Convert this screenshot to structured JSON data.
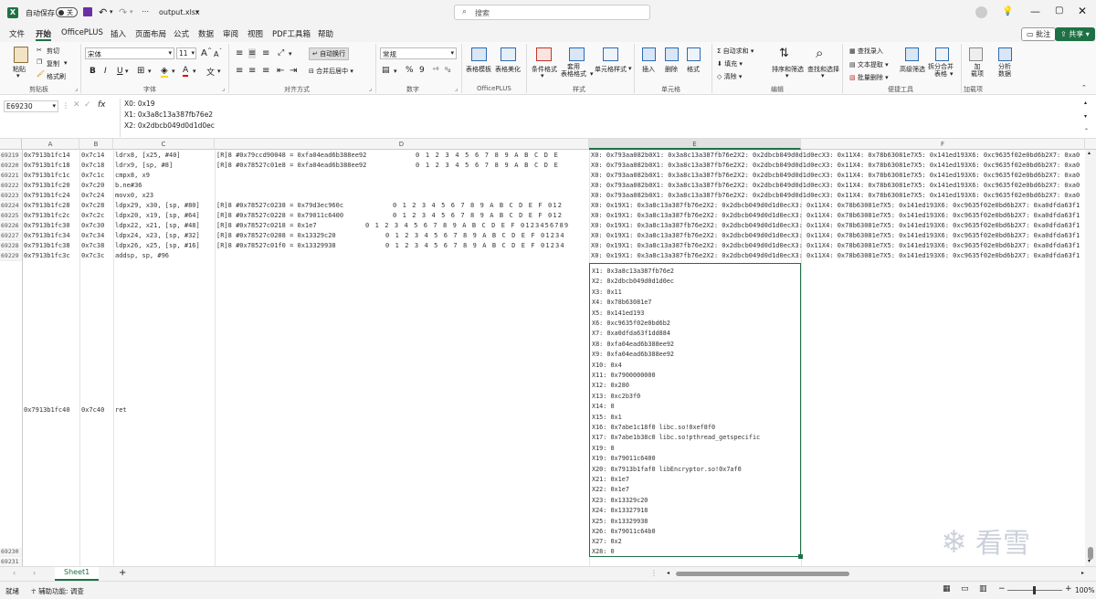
{
  "title_bar": {
    "autosave_label": "自动保存",
    "autosave_state": "关",
    "filename": "output.xlsx",
    "search_placeholder": "搜索"
  },
  "menu": [
    "文件",
    "开始",
    "OfficePLUS",
    "插入",
    "页面布局",
    "公式",
    "数据",
    "审阅",
    "视图",
    "PDF工具箱",
    "帮助"
  ],
  "menu_active": "开始",
  "menu_right": {
    "comment": "批注",
    "share": "共享"
  },
  "ribbon": {
    "clipboard": {
      "paste": "粘贴",
      "cut": "剪切",
      "copy": "复制",
      "format_painter": "格式刷",
      "group": "剪贴板"
    },
    "font": {
      "name": "宋体",
      "size": "11",
      "bold": "B",
      "italic": "I",
      "underline": "U",
      "grow": "A",
      "shrink": "A",
      "color": "A",
      "group": "字体"
    },
    "alignment": {
      "wrap": "自动换行",
      "merge": "合并后居中",
      "group": "对齐方式"
    },
    "number": {
      "format": "常规",
      "percent": "%",
      "comma": "9",
      "group": "数字"
    },
    "officeplus": {
      "table_template": "表格模板",
      "table_beautify": "表格美化",
      "group": "OfficePLUS"
    },
    "styles": {
      "conditional": "条件格式",
      "table_format": "套用\n表格格式",
      "cell_style": "单元格样式",
      "group": "样式"
    },
    "cells": {
      "insert": "插入",
      "delete": "删除",
      "format": "格式",
      "group": "单元格"
    },
    "editing": {
      "autosum": "自动求和",
      "fill": "填充",
      "clear": "清除",
      "sort": "排序和筛选",
      "find": "查找和选择",
      "group": "编辑"
    },
    "tools": {
      "find_insert": "查找录入",
      "text_extract": "文本提取",
      "batch_delete": "批量删除",
      "advanced_filter": "高级筛选",
      "split_merge": "拆分合并\n表格",
      "group": "便捷工具"
    },
    "addins": {
      "addin": "加\n载项",
      "analyze": "分析\n数据",
      "group": "加载项"
    }
  },
  "formula_bar": {
    "name_box": "E69230",
    "fx": "fx",
    "lines": [
      "X0: 0x19",
      "X1: 0x3a8c13a387fb76e2",
      "X2: 0x2dbcb049d0d1d0ec"
    ]
  },
  "columns": [
    "A",
    "B",
    "C",
    "D",
    "E",
    "F"
  ],
  "rows": [
    {
      "n": "69219",
      "a": "0x7913b1fc14",
      "b": "0x7c14",
      "c": "ldrx8, [x25, #40]",
      "d": "[R]8 #0x79ccd90048 = 0xfa04ead6b388ee92",
      "d2": "0 1 2 3 4 5 6 7 8 9 A B C D E",
      "e": "X0: 0x793aa082b0X1: 0x3a8c13a387fb76e2X2: 0x2dbcb049d0d1d0ecX3: 0x11X4: 0x78b63081e7X5: 0x141ed193X6: 0xc9635f02e0bd6b2X7: 0xa0"
    },
    {
      "n": "69220",
      "a": "0x7913b1fc18",
      "b": "0x7c18",
      "c": "ldrx9, [sp, #8]",
      "d": "[R]8 #0x78527c01e8 = 0xfa04ead6b388ee92",
      "d2": "0 1 2 3 4 5 6 7 8 9 A B C D E",
      "e": "X0: 0x793aa082b0X1: 0x3a8c13a387fb76e2X2: 0x2dbcb049d0d1d0ecX3: 0x11X4: 0x78b63081e7X5: 0x141ed193X6: 0xc9635f02e0bd6b2X7: 0xa0"
    },
    {
      "n": "69221",
      "a": "0x7913b1fc1c",
      "b": "0x7c1c",
      "c": "cmpx8, x9",
      "d": "",
      "d2": "",
      "e": "X0: 0x793aa082b0X1: 0x3a8c13a387fb76e2X2: 0x2dbcb049d0d1d0ecX3: 0x11X4: 0x78b63081e7X5: 0x141ed193X6: 0xc9635f02e0bd6b2X7: 0xa0"
    },
    {
      "n": "69222",
      "a": "0x7913b1fc20",
      "b": "0x7c20",
      "c": "b.ne#36",
      "d": "",
      "d2": "",
      "e": "X0: 0x793aa082b0X1: 0x3a8c13a387fb76e2X2: 0x2dbcb049d0d1d0ecX3: 0x11X4: 0x78b63081e7X5: 0x141ed193X6: 0xc9635f02e0bd6b2X7: 0xa0"
    },
    {
      "n": "69223",
      "a": "0x7913b1fc24",
      "b": "0x7c24",
      "c": "movx0, x23",
      "d": "",
      "d2": "",
      "e": "X0: 0x793aa082b0X1: 0x3a8c13a387fb76e2X2: 0x2dbcb049d0d1d0ecX3: 0x11X4: 0x78b63081e7X5: 0x141ed193X6: 0xc9635f02e0bd6b2X7: 0xa0"
    },
    {
      "n": "69224",
      "a": "0x7913b1fc28",
      "b": "0x7c28",
      "c": "ldpx29, x30, [sp, #80]",
      "d": "[R]8 #0x78527c0238 = 0x79d3ec960c",
      "d2": "0 1 2 3 4 5 6 7 8 9 A B C D E F 012",
      "e": "X0: 0x19X1: 0x3a8c13a387fb76e2X2: 0x2dbcb049d0d1d0ecX3: 0x11X4: 0x78b63081e7X5: 0x141ed193X6: 0xc9635f02e0bd6b2X7: 0xa0dfda63f1"
    },
    {
      "n": "69225",
      "a": "0x7913b1fc2c",
      "b": "0x7c2c",
      "c": "ldpx20, x19, [sp, #64]",
      "d": "[R]8 #0x78527c0228 = 0x79011c6400",
      "d2": "0 1 2 3 4 5 6 7 8 9 A B C D E F 012",
      "e": "X0: 0x19X1: 0x3a8c13a387fb76e2X2: 0x2dbcb049d0d1d0ecX3: 0x11X4: 0x78b63081e7X5: 0x141ed193X6: 0xc9635f02e0bd6b2X7: 0xa0dfda63f1"
    },
    {
      "n": "69226",
      "a": "0x7913b1fc30",
      "b": "0x7c30",
      "c": "ldpx22, x21, [sp, #48]",
      "d": "[R]8 #0x78527c0218 = 0x1e7",
      "d2": "0 1 2 3 4 5 6 7 8 9 A B C D E F 0123456789",
      "e": "X0: 0x19X1: 0x3a8c13a387fb76e2X2: 0x2dbcb049d0d1d0ecX3: 0x11X4: 0x78b63081e7X5: 0x141ed193X6: 0xc9635f02e0bd6b2X7: 0xa0dfda63f1"
    },
    {
      "n": "69227",
      "a": "0x7913b1fc34",
      "b": "0x7c34",
      "c": "ldpx24, x23, [sp, #32]",
      "d": "[R]8 #0x78527c0208 = 0x13329c20",
      "d2": "0 1 2 3 4 5 6 7 8 9 A B C D E F 01234",
      "e": "X0: 0x19X1: 0x3a8c13a387fb76e2X2: 0x2dbcb049d0d1d0ecX3: 0x11X4: 0x78b63081e7X5: 0x141ed193X6: 0xc9635f02e0bd6b2X7: 0xa0dfda63f1"
    },
    {
      "n": "69228",
      "a": "0x7913b1fc38",
      "b": "0x7c38",
      "c": "ldpx26, x25, [sp, #16]",
      "d": "[R]8 #0x78527c01f0 = 0x13329938",
      "d2": "0 1 2 3 4 5 6 7 8 9 A B C D E F 01234",
      "e": "X0: 0x19X1: 0x3a8c13a387fb76e2X2: 0x2dbcb049d0d1d0ecX3: 0x11X4: 0x78b63081e7X5: 0x141ed193X6: 0xc9635f02e0bd6b2X7: 0xa0dfda63f1"
    },
    {
      "n": "69229",
      "a": "0x7913b1fc3c",
      "b": "0x7c3c",
      "c": "addsp, sp, #96",
      "d": "",
      "d2": "",
      "e": "X0: 0x19X1: 0x3a8c13a387fb76e2X2: 0x2dbcb049d0d1d0ecX3: 0x11X4: 0x78b63081e7X5: 0x141ed193X6: 0xc9635f02e0bd6b2X7: 0xa0dfda63f1"
    }
  ],
  "big_row": {
    "n": "69230",
    "a": "0x7913b1fc40",
    "b": "0x7c40",
    "c": "ret"
  },
  "bottom_rows": [
    "69230",
    "69231"
  ],
  "registers": [
    "X1: 0x3a8c13a387fb76e2",
    "X2: 0x2dbcb049d0d1d0ec",
    "X3: 0x11",
    "X4: 0x78b63081e7",
    "X5: 0x141ed193",
    "X6: 0xc9635f02e0bd6b2",
    "X7: 0xa0dfda63f1dd884",
    "X8: 0xfa04ead6b388ee92",
    "X9: 0xfa04ead6b388ee92",
    "X10: 0x4",
    "X11: 0x7900000000",
    "X12: 0x280",
    "X13: 0xc2b3f0",
    "X14: 0",
    "X15: 0x1",
    "X16: 0x7abe1c18f0 libc.so!0xef8f0",
    "X17: 0x7abe1b38c0 libc.so!pthread_getspecific",
    "X19: 0",
    "X19: 0x79011c6400",
    "X20: 0x7913b1faf0 libEncryptor.so!0x7af0",
    "X21: 0x1e7",
    "X22: 0x1e7",
    "X23: 0x13329c20",
    "X24: 0x13327918",
    "X25: 0x13329938",
    "X26: 0x79011c64b0",
    "X27: 0x2",
    "X28: 0"
  ],
  "sheet_tab": "Sheet1",
  "status": {
    "ready": "就绪",
    "accessibility": "辅助功能: 调查",
    "zoom": "100%"
  },
  "watermark": "看雪"
}
